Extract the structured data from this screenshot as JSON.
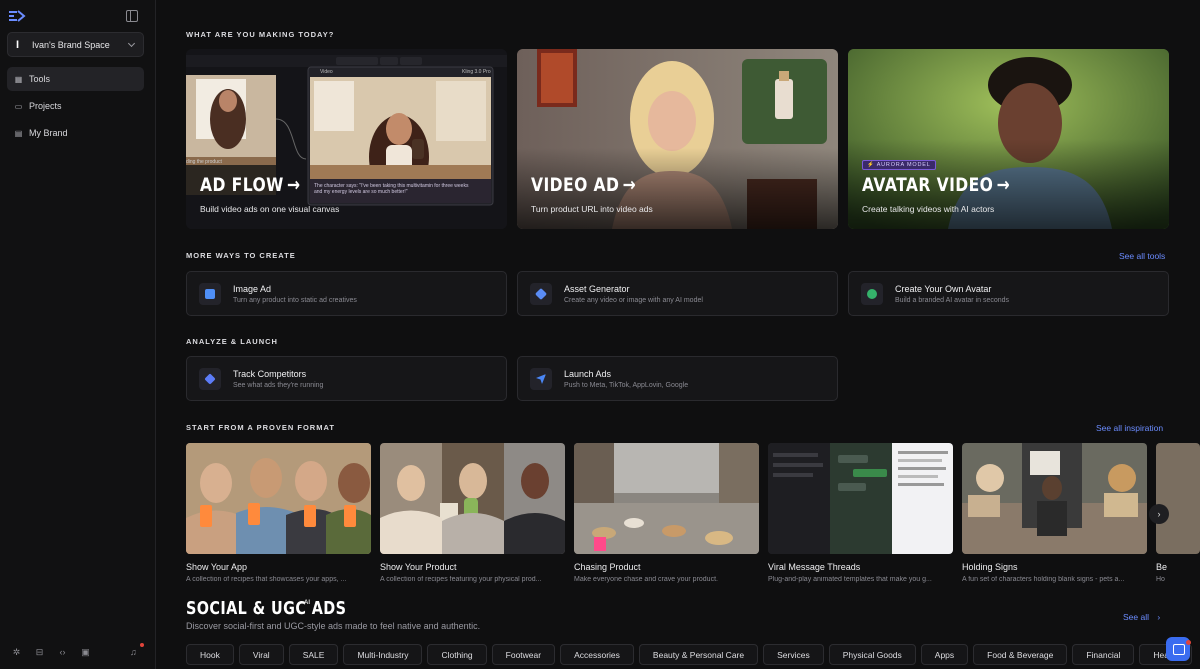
{
  "sidebar": {
    "brand_initial": "I",
    "brand_name": "Ivan's Brand Space",
    "items": [
      {
        "label": "Tools",
        "icon": "grid-icon"
      },
      {
        "label": "Projects",
        "icon": "folder-icon"
      },
      {
        "label": "My Brand",
        "icon": "brand-book-icon"
      }
    ]
  },
  "sections": {
    "making": "WHAT ARE YOU MAKING TODAY?",
    "more_ways": "MORE WAYS TO CREATE",
    "analyze": "ANALYZE & LAUNCH",
    "proven": "START FROM A PROVEN FORMAT",
    "see_all_tools": "See all tools",
    "see_all_inspiration": "See all inspiration"
  },
  "heroes": [
    {
      "title": "AD FLOW",
      "subtitle": "Build video ads on one visual canvas"
    },
    {
      "title": "VIDEO AD",
      "subtitle": "Turn product URL into video ads"
    },
    {
      "title": "AVATAR VIDEO",
      "subtitle": "Create talking videos with AI actors",
      "badge": "AURORA MODEL"
    }
  ],
  "hero_details": {
    "flow_caption": "The character says: \"I've been taking this multivitamin for three weeks and my energy levels are so much better!\"",
    "flow_node_label": "ding the product",
    "flow_video_label": "Video",
    "flow_model": "Kling 3.0 Pro"
  },
  "create_tools": [
    {
      "title": "Image Ad",
      "subtitle": "Turn any product into static ad creatives",
      "color": "#4f8ff7"
    },
    {
      "title": "Asset Generator",
      "subtitle": "Create any video or image with any AI model",
      "color": "#5a8cf5"
    },
    {
      "title": "Create Your Own Avatar",
      "subtitle": "Build a branded AI avatar in seconds",
      "color": "#35b26b"
    }
  ],
  "launch_tools": [
    {
      "title": "Track Competitors",
      "subtitle": "See what ads they're running",
      "color": "#5c7cf7"
    },
    {
      "title": "Launch Ads",
      "subtitle": "Push to Meta, TikTok, AppLovin, Google",
      "color": "#4a86f5"
    }
  ],
  "formats": [
    {
      "title": "Show Your App",
      "desc": "A collection of recipes that showcases your apps, ..."
    },
    {
      "title": "Show Your Product",
      "desc": "A collection of recipes featuring your physical prod..."
    },
    {
      "title": "Chasing Product",
      "desc": "Make everyone chase and crave your product."
    },
    {
      "title": "Viral Message Threads",
      "desc": "Plug-and-play animated templates that make you g..."
    },
    {
      "title": "Holding Signs",
      "desc": "A fun set of characters holding blank signs - pets a..."
    },
    {
      "title": "Be",
      "desc": "Ho"
    }
  ],
  "social": {
    "title": "SOCIAL & UGC ADS",
    "badge": "AI",
    "subtitle": "Discover social-first and UGC-style ads made to feel native and authentic.",
    "see_all": "See all",
    "chips": [
      "Hook",
      "Viral",
      "SALE",
      "Multi-Industry",
      "Clothing",
      "Footwear",
      "Accessories",
      "Beauty & Personal Care",
      "Services",
      "Physical Goods",
      "Apps",
      "Food & Beverage",
      "Financial",
      "Health"
    ]
  },
  "colors": {
    "accent": "#6b8cff",
    "background": "#0f0f10"
  }
}
